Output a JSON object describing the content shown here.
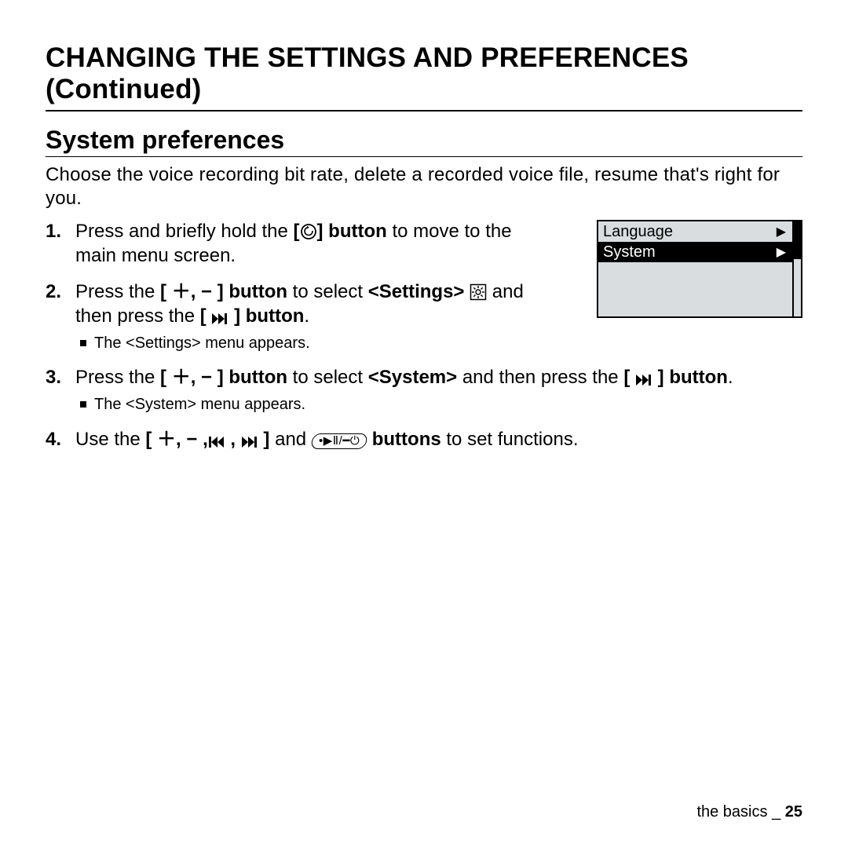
{
  "page_title": "CHANGING THE SETTINGS AND PREFERENCES (Continued)",
  "section_title": "System preferences",
  "intro": "Choose the voice recording bit rate, delete a recorded voice file, resume that's right for you.",
  "steps": {
    "s1": {
      "a": "Press and briefly hold the ",
      "bracket_open": "[",
      "bracket_close": "]",
      "b": " button",
      "c": " to move to the main menu screen."
    },
    "s2": {
      "a": "Press the ",
      "btn1": "[ ＋, − ] button",
      "b": " to select ",
      "settings": "<Settings>",
      "c": " and then press the ",
      "btn2_open": "[ ",
      "btn2_close": " ] button",
      "d": ".",
      "sub": "The <Settings> menu appears."
    },
    "s3": {
      "a": "Press the ",
      "btn1": "[ ＋, − ] button",
      "b": " to select ",
      "system": "<System>",
      "c": " and then press the ",
      "btn2_open": "[ ",
      "btn2_close": " ] button",
      "d": ".",
      "sub": "The <System> menu appears."
    },
    "s4": {
      "a": "Use the ",
      "btn_open": "[ ＋, − ,",
      "btn_mid": " , ",
      "btn_close": " ]",
      "b": " and ",
      "c": " buttons",
      "d": " to set functions."
    }
  },
  "device": {
    "item1": "Language",
    "item2": "System",
    "arrow": "▶"
  },
  "footer": {
    "section": "the basics",
    "sep": "_",
    "page": "25"
  },
  "lozenge_text": "•▶Ⅱ/━⏻"
}
